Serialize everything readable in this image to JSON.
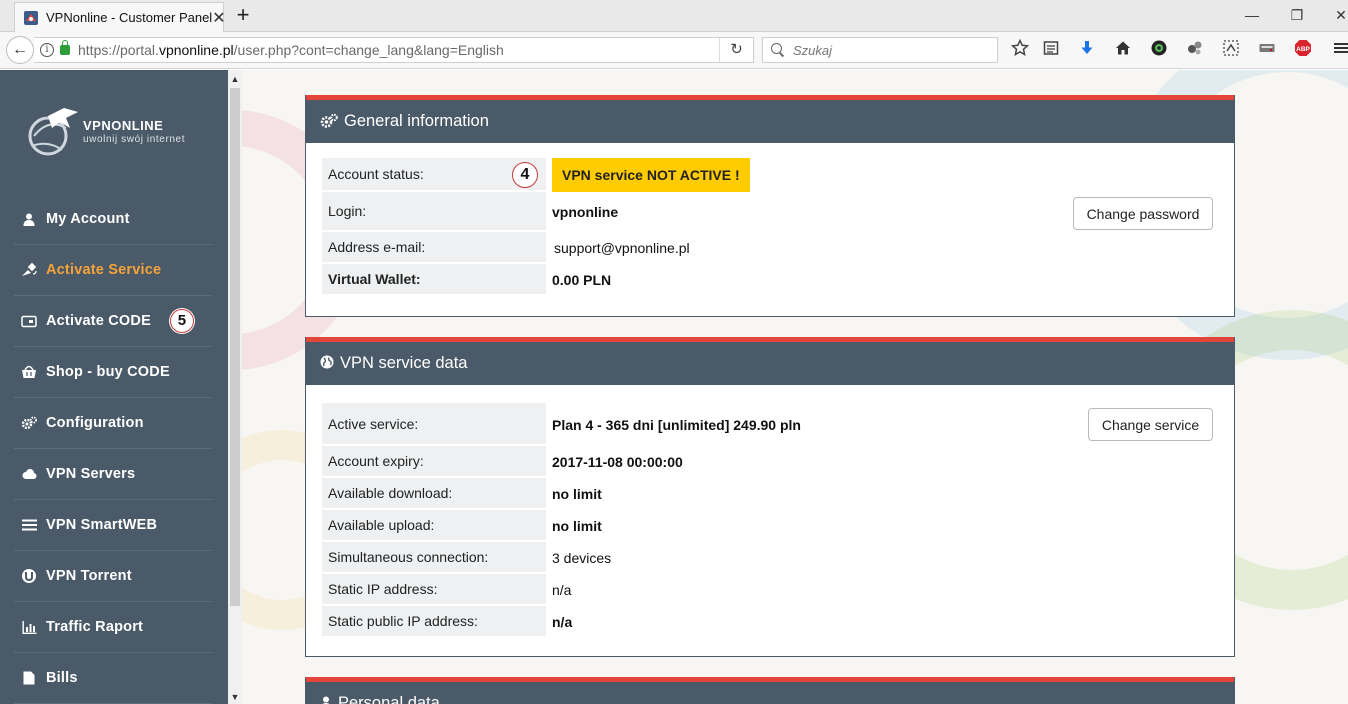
{
  "browser": {
    "tab_title": "VPNonline - Customer Panel",
    "tab_close": "✕",
    "new_tab": "+",
    "url_prefix": "https://portal.",
    "url_domain": "vpnonline.pl",
    "url_path": "/user.php?cont=change_lang&lang=English",
    "search_placeholder": "Szukaj",
    "win_min": "—",
    "win_max": "❐",
    "win_close": "✕",
    "back": "←",
    "reload": "↻",
    "info": "i",
    "toolbar_icons": [
      "star-icon",
      "reader-icon",
      "download-icon",
      "home-icon",
      "extension-icon",
      "extension-icon",
      "extension-icon",
      "extension-icon",
      "adblock-icon",
      "menu-icon"
    ]
  },
  "sidebar": {
    "brand": "VPNONLINE",
    "tagline": "uwolnij swój internet",
    "items": [
      {
        "label": "My Account",
        "icon": "user-icon"
      },
      {
        "label": "Activate Service",
        "icon": "satellite-icon",
        "active": true
      },
      {
        "label": "Activate CODE",
        "icon": "card-icon",
        "badge": "5"
      },
      {
        "label": "Shop - buy CODE",
        "icon": "basket-icon"
      },
      {
        "label": "Configuration",
        "icon": "gears-icon"
      },
      {
        "label": "VPN Servers",
        "icon": "cloud-icon"
      },
      {
        "label": "VPN SmartWEB",
        "icon": "list-icon"
      },
      {
        "label": "VPN Torrent",
        "icon": "torrent-icon"
      },
      {
        "label": "Traffic Raport",
        "icon": "bar-chart-icon"
      },
      {
        "label": "Bills",
        "icon": "document-icon"
      }
    ]
  },
  "general": {
    "title": "General information",
    "status_label": "Account status:",
    "status_value": "VPN service NOT ACTIVE !",
    "status_badge": "4",
    "login_label": "Login:",
    "login_value": "vpnonline",
    "email_label": "Address e-mail:",
    "email_value": "support@vpnonline.pl",
    "wallet_label": "Virtual Wallet:",
    "wallet_value": "0.00 PLN",
    "change_password": "Change password"
  },
  "service": {
    "title": "VPN service data",
    "change_service": "Change service",
    "rows": [
      {
        "label": "Active service:",
        "value": "Plan 4 - 365 dni [unlimited] 249.90 pln"
      },
      {
        "label": "Account expiry:",
        "value": "2017-11-08 00:00:00"
      },
      {
        "label": "Available download:",
        "value": "no limit"
      },
      {
        "label": "Available upload:",
        "value": "no limit"
      },
      {
        "label": "Simultaneous connection:",
        "value": "3 devices"
      },
      {
        "label": "Static IP address:",
        "value": "n/a"
      },
      {
        "label": "Static public IP address:",
        "value": "n/a"
      }
    ]
  },
  "personal": {
    "title": "Personal data"
  },
  "colors": {
    "sidebar_bg": "#4b5a68",
    "accent_red": "#e2463b",
    "active_orange": "#f5a33a",
    "warning_yellow": "#ffcc00",
    "wallet_red": "#d0021b"
  }
}
